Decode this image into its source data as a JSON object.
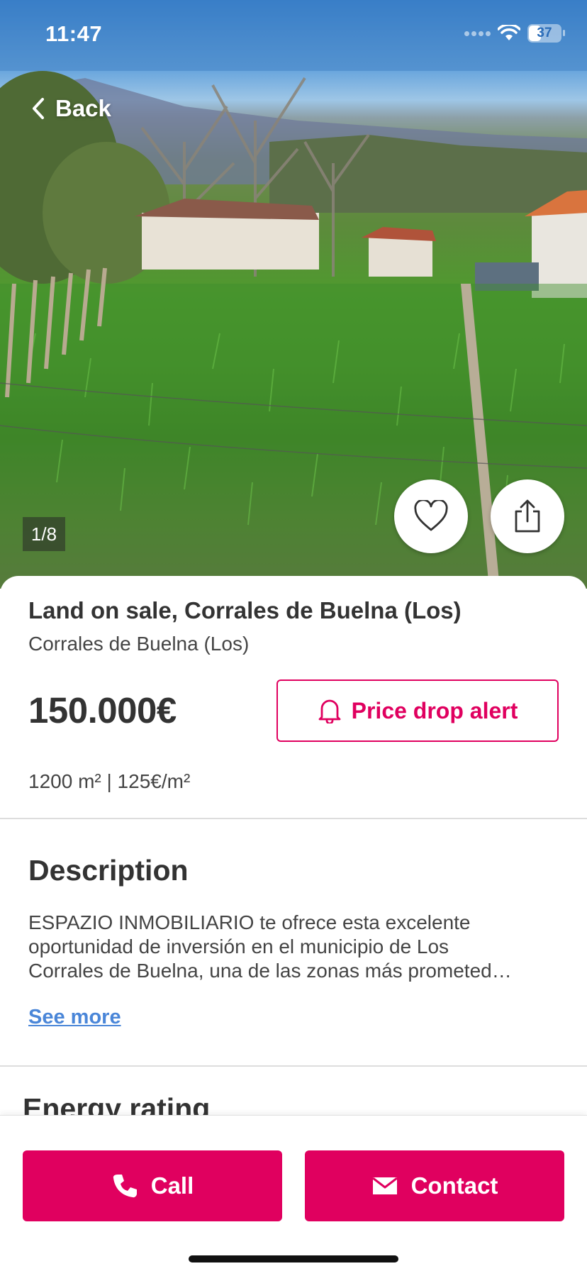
{
  "status_bar": {
    "time": "11:47",
    "battery": "37"
  },
  "nav": {
    "back_label": "Back"
  },
  "gallery": {
    "counter": "1/8",
    "icons": [
      "heart-icon",
      "share-icon"
    ]
  },
  "listing": {
    "title": "Land on sale, Corrales de Buelna (Los)",
    "location": "Corrales de Buelna (Los)",
    "price": "150.000€",
    "price_alert_label": "Price drop alert",
    "size_line": "1200 m² | 125€/m²"
  },
  "description": {
    "heading": "Description",
    "lines": [
      "ESPAZIO INMOBILIARIO te ofrece esta excelente",
      "oportunidad de inversión en el municipio de Los",
      "Corrales de Buelna, una de las zonas más prometed…"
    ],
    "see_more_label": "See more"
  },
  "energy": {
    "heading": "Energy rating"
  },
  "actions": {
    "call_label": "Call",
    "contact_label": "Contact"
  },
  "colors": {
    "accent": "#e0005f",
    "link": "#4a86d8",
    "text": "#333333"
  }
}
